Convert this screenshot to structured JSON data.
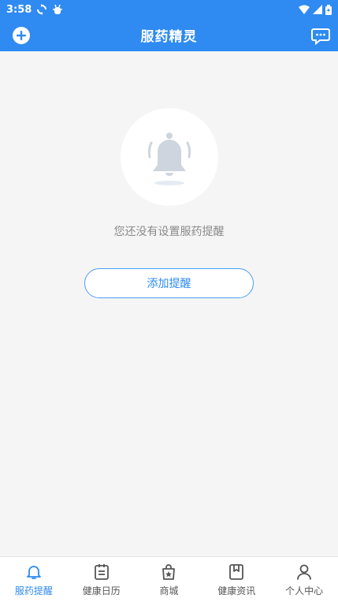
{
  "status_bar": {
    "time": "3:58"
  },
  "header": {
    "title": "服药精灵"
  },
  "empty_state": {
    "message": "您还没有设置服药提醒",
    "add_button_label": "添加提醒"
  },
  "tabs": [
    {
      "label": "服药提醒",
      "icon": "bell-icon",
      "active": true
    },
    {
      "label": "健康日历",
      "icon": "calendar-icon",
      "active": false
    },
    {
      "label": "商城",
      "icon": "shopping-bag-icon",
      "active": false
    },
    {
      "label": "健康资讯",
      "icon": "bookmark-icon",
      "active": false
    },
    {
      "label": "个人中心",
      "icon": "person-icon",
      "active": false
    }
  ],
  "colors": {
    "primary": "#2f8bf1",
    "background": "#f5f5f5",
    "tab_inactive": "#555555",
    "bell_gray": "#cfd5de"
  }
}
